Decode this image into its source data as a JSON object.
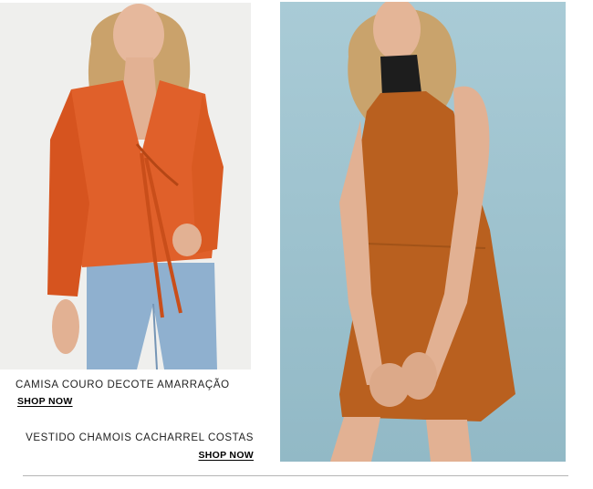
{
  "products": [
    {
      "name": "CAMISA COURO DECOTE AMARRAÇÃO",
      "cta": "SHOP NOW",
      "image": "model-orange-leather-shirt-jeans",
      "background_color": "#eeeeec",
      "garment_color": "#e0602a"
    },
    {
      "name": "VESTIDO CHAMOIS CACHARREL COSTAS",
      "cta": "SHOP NOW",
      "image": "model-cognac-suede-dress",
      "background_color": "#9fc3cf",
      "garment_color": "#b9601f"
    }
  ]
}
